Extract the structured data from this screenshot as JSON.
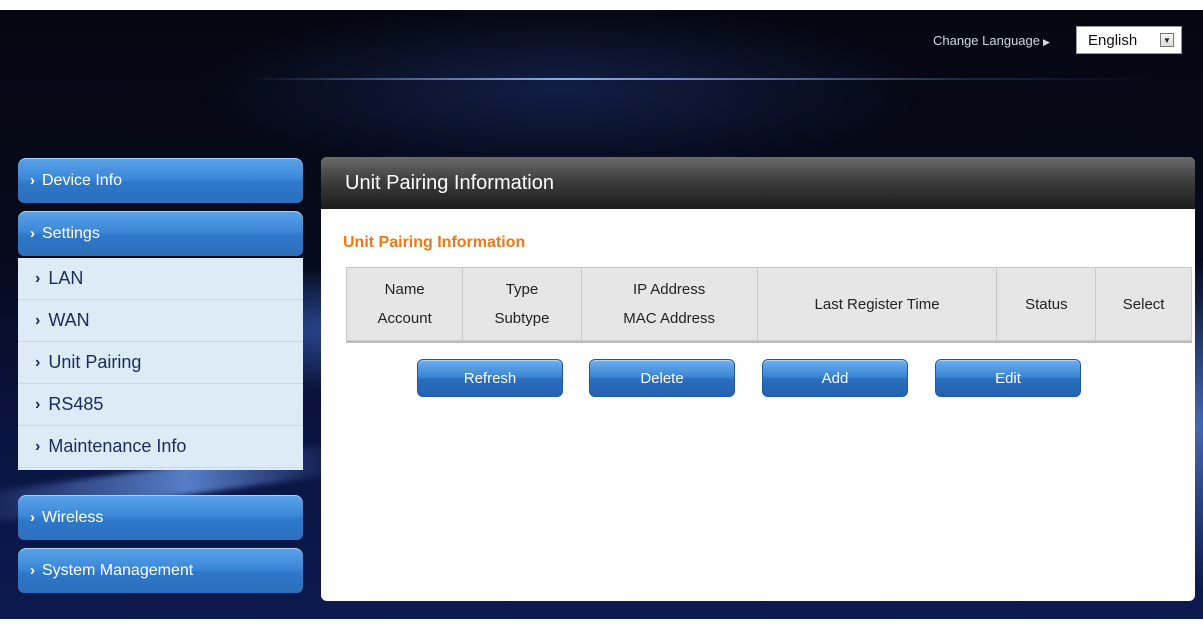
{
  "header": {
    "change_language_label": "Change Language",
    "language_value": "English"
  },
  "sidebar": {
    "device_info": "Device Info",
    "settings": "Settings",
    "settings_items": [
      {
        "label": "LAN"
      },
      {
        "label": "WAN"
      },
      {
        "label": "Unit Pairing"
      },
      {
        "label": "RS485"
      },
      {
        "label": "Maintenance Info"
      }
    ],
    "wireless": "Wireless",
    "system_management": "System Management"
  },
  "main": {
    "title": "Unit Pairing Information",
    "section_title": "Unit Pairing Information",
    "table": {
      "columns": [
        {
          "line1": "Name",
          "line2": "Account"
        },
        {
          "line1": "Type",
          "line2": "Subtype"
        },
        {
          "line1": "IP Address",
          "line2": "MAC Address"
        },
        {
          "line1": "Last Register Time",
          "line2": ""
        },
        {
          "line1": "Status",
          "line2": ""
        },
        {
          "line1": "Select",
          "line2": ""
        }
      ]
    },
    "buttons": {
      "refresh": "Refresh",
      "delete": "Delete",
      "add": "Add",
      "edit": "Edit"
    }
  },
  "colors": {
    "section_title": "#f07812",
    "menu_blue": "#3d88d8",
    "submenu_bg": "#ddebf7",
    "table_header_bg": "#e6e6e6"
  }
}
